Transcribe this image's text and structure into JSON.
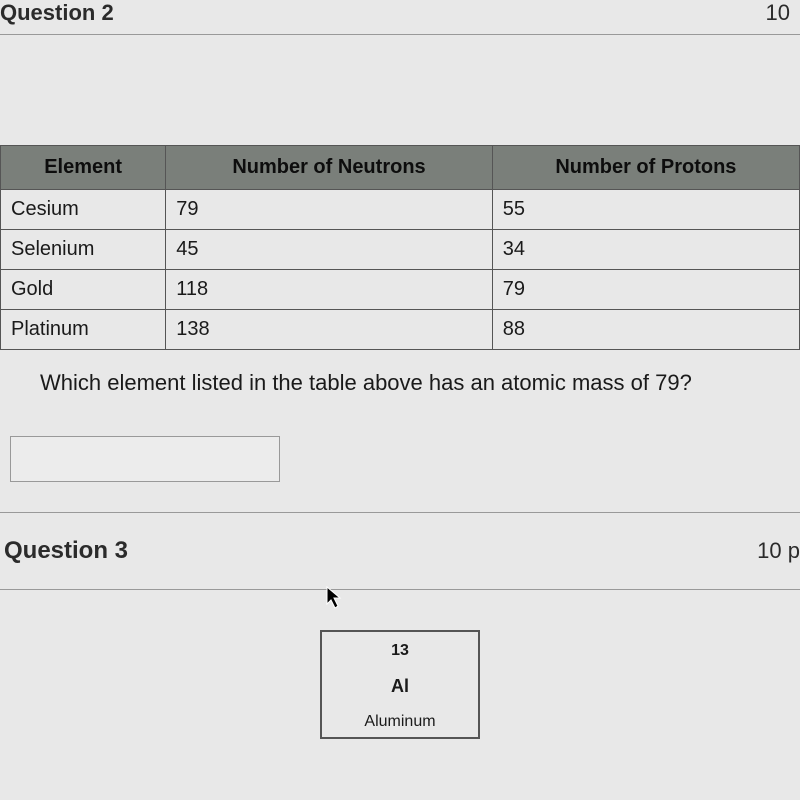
{
  "question2": {
    "title": "Question 2",
    "points": "10",
    "table": {
      "headers": [
        "Element",
        "Number of Neutrons",
        "Number of Protons"
      ],
      "rows": [
        {
          "element": "Cesium",
          "neutrons": "79",
          "protons": "55"
        },
        {
          "element": "Selenium",
          "neutrons": "45",
          "protons": "34"
        },
        {
          "element": "Gold",
          "neutrons": "118",
          "protons": "79"
        },
        {
          "element": "Platinum",
          "neutrons": "138",
          "protons": "88"
        }
      ]
    },
    "prompt": "Which element listed in the table above has an atomic mass of 79?",
    "answer_value": ""
  },
  "question3": {
    "title": "Question 3",
    "points": "10 p",
    "tile": {
      "atomic_number": "13",
      "symbol": "Al",
      "name": "Aluminum"
    }
  }
}
